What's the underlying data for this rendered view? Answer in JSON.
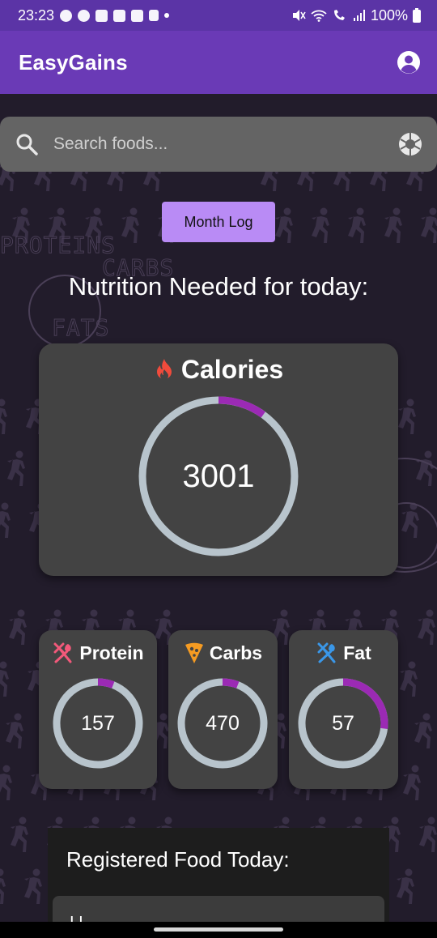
{
  "status": {
    "time": "23:23",
    "battery": "100%"
  },
  "app": {
    "title": "EasyGains",
    "account_icon": "account-circle-icon"
  },
  "search": {
    "placeholder": "Search foods...",
    "icon": "search-icon",
    "camera_icon": "camera-icon"
  },
  "month_log_label": "Month Log",
  "heading": "Nutrition Needed for today:",
  "calories": {
    "label": "Calories",
    "value": "3001",
    "progress": 0.1,
    "icon": "flame-icon",
    "icon_color": "#f04b3c"
  },
  "macros": [
    {
      "label": "Protein",
      "value": "157",
      "progress": 0.06,
      "icon": "utensils-icon",
      "icon_color": "#f2597a"
    },
    {
      "label": "Carbs",
      "value": "470",
      "progress": 0.06,
      "icon": "pizza-icon",
      "icon_color": "#f59b22"
    },
    {
      "label": "Fat",
      "value": "57",
      "progress": 0.27,
      "icon": "utensils-icon",
      "icon_color": "#3a97e8"
    }
  ],
  "colors": {
    "app_bar": "#6a3ab6",
    "ring_track": "#b8c4cc",
    "ring_progress": "#9b2ab4",
    "accent_button": "#b98bf5"
  },
  "registered": {
    "title": "Registered Food Today:",
    "first_item": "I I"
  }
}
